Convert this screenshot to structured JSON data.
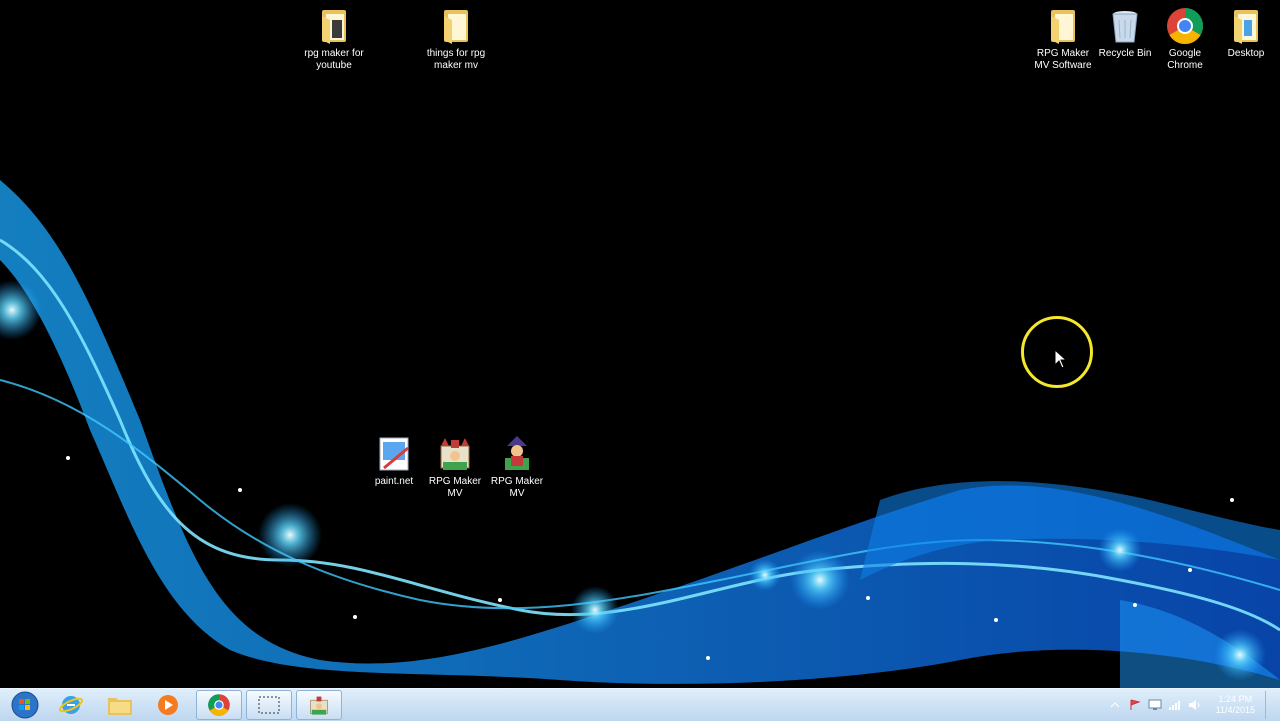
{
  "desktop": {
    "icons": [
      {
        "label": "rpg maker for youtube",
        "icon": "folder-icon"
      },
      {
        "label": "things for rpg maker mv",
        "icon": "folder-icon"
      },
      {
        "label": "RPG Maker MV Software",
        "icon": "folder-icon"
      },
      {
        "label": "Recycle Bin",
        "icon": "recycle-bin-icon"
      },
      {
        "label": "Google Chrome",
        "icon": "chrome-icon"
      },
      {
        "label": "Desktop",
        "icon": "folder-icon"
      },
      {
        "label": "paint.net",
        "icon": "paint-net-icon"
      },
      {
        "label": "RPG Maker MV",
        "icon": "rpg-maker-mv-icon"
      },
      {
        "label": "RPG Maker MV",
        "icon": "rpg-maker-mv-icon"
      }
    ]
  },
  "taskbar": {
    "buttons": [
      {
        "name": "start-button",
        "icon": "windows-orb-icon"
      },
      {
        "name": "internet-explorer",
        "icon": "internet-explorer-icon"
      },
      {
        "name": "file-explorer",
        "icon": "folder-icon"
      },
      {
        "name": "media-player",
        "icon": "media-player-icon"
      },
      {
        "name": "google-chrome",
        "icon": "chrome-icon"
      },
      {
        "name": "snipping-tool",
        "icon": "snipping-tool-icon"
      },
      {
        "name": "rpg-maker-mv",
        "icon": "rpg-maker-mv-icon"
      }
    ],
    "clock": {
      "time": "1:24 PM",
      "date": "11/4/2015"
    }
  },
  "colors": {
    "cursor_highlight": "#f5e82a",
    "wallpaper_accent": "#1e9cff",
    "taskbar": "#bdd6ef"
  }
}
